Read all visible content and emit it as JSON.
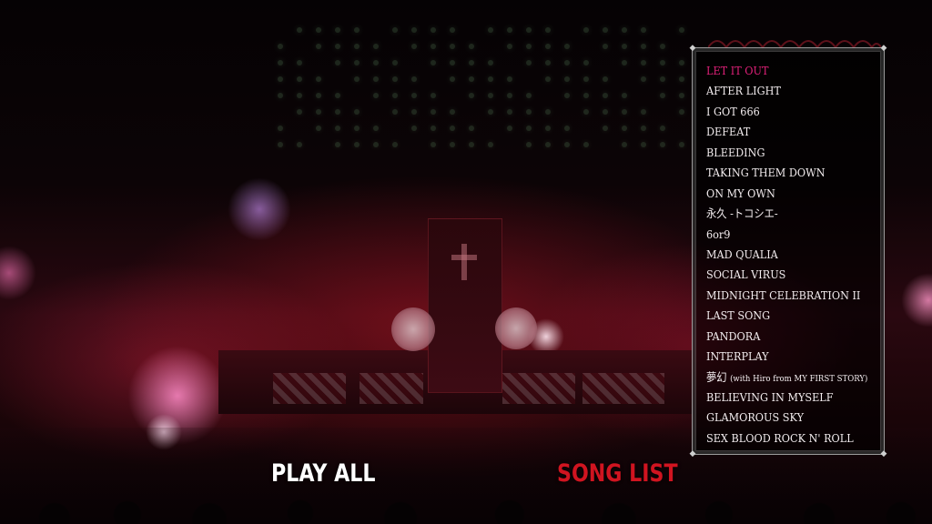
{
  "menu": {
    "play_all_label": "PLAY ALL",
    "song_list_label": "SONG LIST",
    "active_item": "song_list"
  },
  "song_list": {
    "selected_index": 0,
    "items": [
      "LET IT OUT",
      "AFTER LIGHT",
      "I GOT 666",
      "DEFEAT",
      "BLEEDING",
      "TAKING THEM DOWN",
      "ON MY OWN",
      "永久 -トコシエ-",
      "6or9",
      "MAD QUALIA",
      "SOCIAL VIRUS",
      "MIDNIGHT CELEBRATION II",
      "LAST SONG",
      "PANDORA",
      "INTERPLAY",
      "夢幻 (with Hiro from MY FIRST STORY)",
      "BELIEVING IN MYSELF",
      "GLAMOROUS SKY",
      "SEX BLOOD ROCK N' ROLL"
    ]
  },
  "colors": {
    "play_all": "#ffffff",
    "song_list_active": "#d01420",
    "selected_song": "#e2217a",
    "song_text": "#f4eef0",
    "panel_border": "#cdcdcd"
  }
}
